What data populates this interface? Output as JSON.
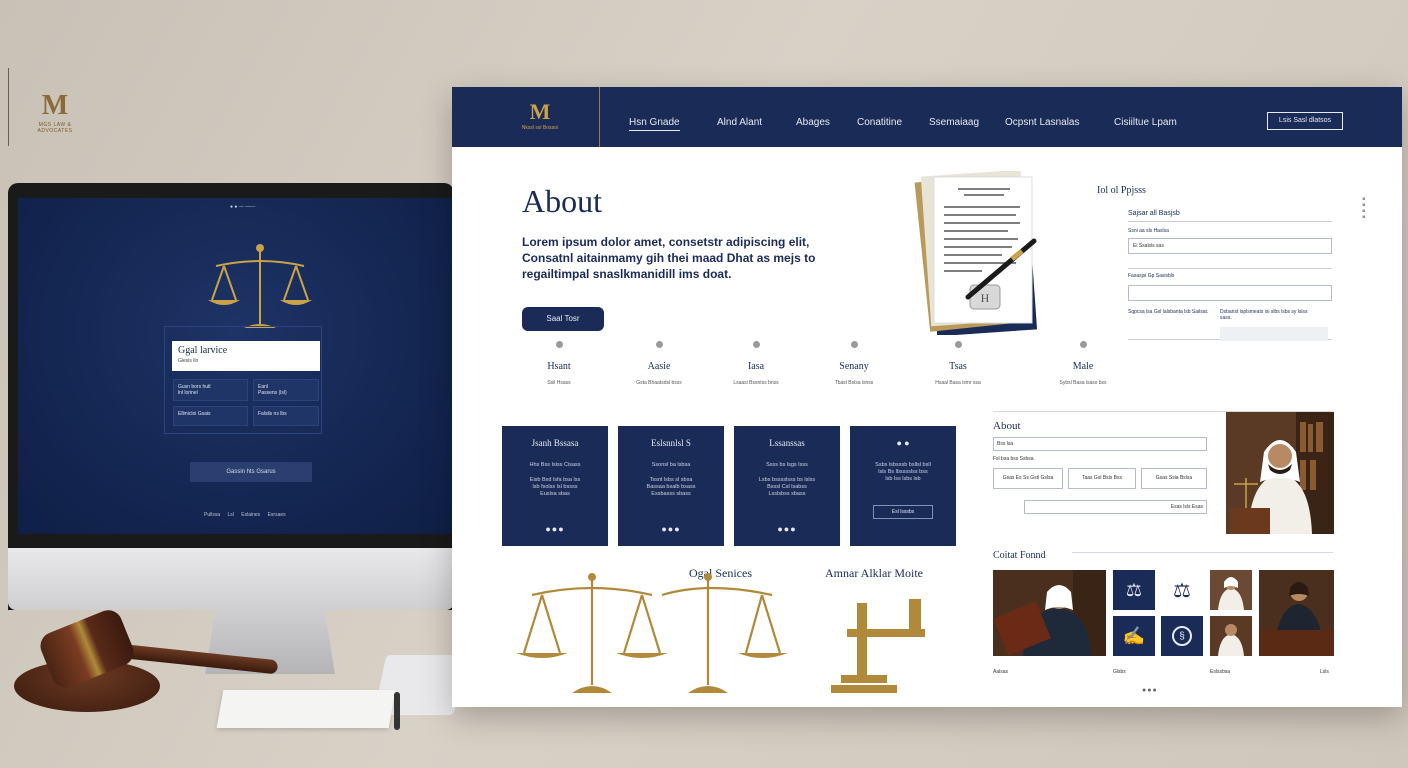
{
  "wall": {
    "logo_letter": "M",
    "logo_text": "MGS LAW & ADVOCATES"
  },
  "imac": {
    "apple_glyph": "",
    "nav_text": "● ●  —  ——",
    "card_title": "Ggal larvice",
    "card_sub": "Glesis llo",
    "boxes": [
      "Gusn bors hutl\nlnl lorinel",
      "Eanl\nPassens (lsl)",
      "Ellmicloi Gsais",
      "Falsils ns lbs"
    ],
    "button": "Gassin hts Gsarus",
    "links": "Pullssa   Lsl   Eslaines   Esrsaes"
  },
  "site": {
    "logo_letter": "M",
    "logo_text": "Nkssl ssi Bnsaoi",
    "nav": [
      "Hsn Gnade",
      "Alnd Alant",
      "Abages",
      "Conatitine",
      "Ssemaiaag",
      "Ocpsnt Lasnalas",
      "Cisiiltue Lpam"
    ],
    "header_button": "Lsis Sasl dlatsos",
    "hero_title": "About",
    "lead": "Lorem ipsum dolor amet, consetstr adipiscing elit, Consatnl aitainmamy gih thei maad Dhat as mejs to regailtimpal snaslkmanidill ims doat.",
    "hero_button": "Saal Tosr",
    "steps": [
      {
        "label": "Hsant",
        "sub": "Ssil Hsass"
      },
      {
        "label": "Aasie",
        "sub": "Gsta Bhaatsdsl bsss"
      },
      {
        "label": "Iasa",
        "sub": "Lsaasi Bssntss bnss"
      },
      {
        "label": "Senany",
        "sub": "Tbasl Bslsa lsnss"
      },
      {
        "label": "Tsas",
        "sub": "Hsaal Basa lsmr ssa"
      },
      {
        "label": "Male",
        "sub": "Sybsl Basa lsass bss"
      }
    ],
    "form": {
      "title": "Iol ol Ppjsss",
      "field1_label": "Sajsar all Basjsb",
      "field1_hint": "Ssni aa sls Haslsa",
      "field1_value": "Ei Ssalsls sas",
      "field2_label": "Fasasjsi Gp Sasisbls",
      "note_left": "Sqpcsa lsa Gsl lalsbanta lsb Sailsat.",
      "note_right": "Dsbanst isplsmeats isi slbs lsbs sy lslss sass."
    },
    "services": [
      {
        "title": "Jsanh Bssasa",
        "sub": "Hhs Bss Isiss Cisass",
        "body": "Eisb Bsd lsfa bsa lss\nlsb fsolss lsl bssss\nEuslsa sbas",
        "dots": "●●●"
      },
      {
        "title": "Eslsnnlsl S",
        "sub": "Ssonsl ba lsbsa",
        "body": "Tssnt lsbs sl sbsa\nBassaa bsalb bsass\nEssbasss sbass",
        "dots": "●●●"
      },
      {
        "title": "Lssanssas",
        "sub": "Ssss bs lsgs Isss",
        "body": "Lsbs bsssslsss bs lslss\nBsssl Csl lsabss\nLsslsbss sbass",
        "dots": "●●●"
      },
      {
        "title": "● ●",
        "sub": "",
        "body": "Ssbs lsbsssb bsllsl bsll\nlsls Bs lbsssslss bss\nlsb lss lsbs lsb",
        "dots": "",
        "button": "Esl lsssbs"
      }
    ],
    "about2": {
      "title": "About",
      "input1": "Bss lsa",
      "input1_sub": "Fsl bsa bss Ssbsa",
      "buttons": [
        "Gsas Es Ss Gstl Gslsa",
        "Taas Gsl Bsls Bss",
        "Gsas Ssia Bslsa"
      ],
      "input2_right": "Esas lsls Esas"
    },
    "contact_title": "Coitat Fonnd",
    "legal_services_title": "Ogal Senices",
    "amnar_title": "Amnar Alklar Moite",
    "gallery_captions": [
      "Aalsas",
      "Glsbs",
      "Eslssbsa",
      "Lsls"
    ],
    "pager": "●●●"
  }
}
